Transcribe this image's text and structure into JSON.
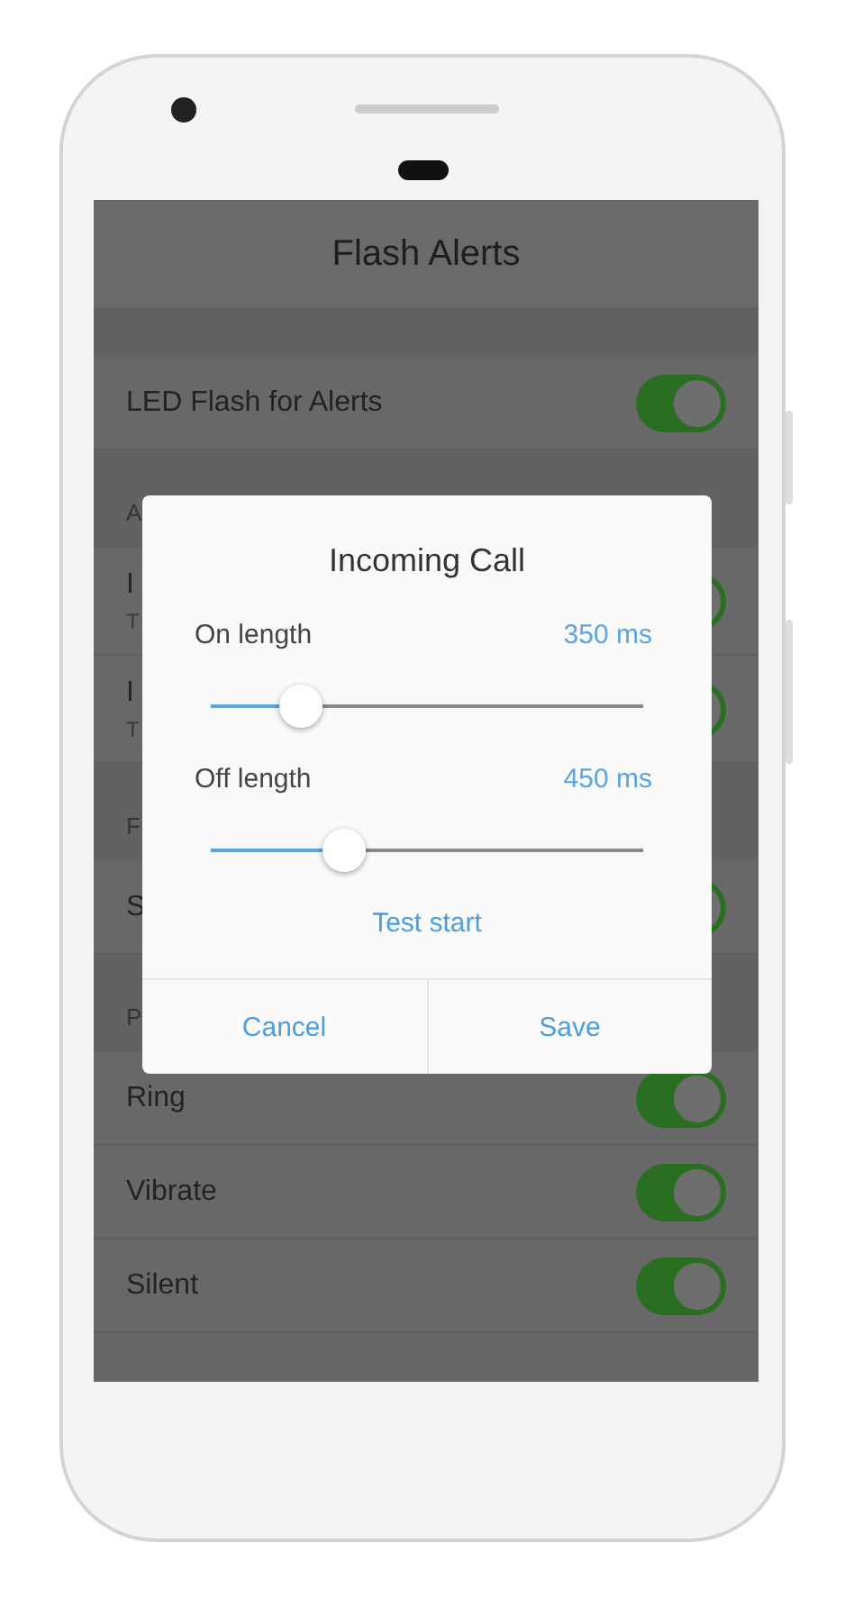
{
  "app_bar": {
    "title": "Flash Alerts"
  },
  "settings": [
    {
      "kind": "spacer"
    },
    {
      "kind": "toggle",
      "label": "LED Flash for Alerts",
      "on": true
    },
    {
      "kind": "section",
      "label": "A"
    },
    {
      "kind": "toggle",
      "label": "I",
      "subtitle": "T",
      "on": true
    },
    {
      "kind": "toggle",
      "label": "I",
      "subtitle": "T",
      "on": true
    },
    {
      "kind": "section",
      "label": "F"
    },
    {
      "kind": "toggle",
      "label": "S",
      "on": true
    },
    {
      "kind": "section",
      "label": "P"
    },
    {
      "kind": "toggle",
      "label": "Ring",
      "on": true
    },
    {
      "kind": "toggle",
      "label": "Vibrate",
      "on": true
    },
    {
      "kind": "toggle",
      "label": "Silent",
      "on": true
    }
  ],
  "dialog": {
    "title": "Incoming Call",
    "sliders": [
      {
        "label": "On length",
        "reading": "350 ms",
        "level": 0.21
      },
      {
        "label": "Off length",
        "reading": "450 ms",
        "level": 0.31
      }
    ],
    "link": "Test start",
    "buttons": [
      "Cancel",
      "Save"
    ]
  }
}
